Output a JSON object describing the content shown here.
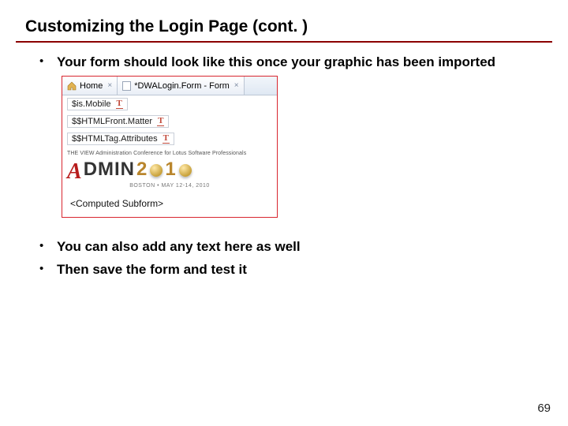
{
  "title": "Customizing the Login Page (cont. )",
  "bullets": {
    "b1": "Your form should look like this once your graphic has been imported",
    "b2": "You can also add any text here as well",
    "b3": "Then save the form and test it"
  },
  "screenshot": {
    "tab_home": "Home",
    "tab_form": "*DWALogin.Form - Form",
    "field_ismobile": "$is.Mobile",
    "field_frontmatter": "$$HTMLFront.Matter",
    "field_tagattrs": "$$HTMLTag.Attributes",
    "logo_topline": "THE VIEW Administration Conference for Lotus Software Professionals",
    "logo_a": "A",
    "logo_dmin": "DMIN",
    "logo_2": "2",
    "logo_1": "1",
    "logo_sub": "BOSTON • MAY 12-14, 2010",
    "subform": "<Computed Subform>"
  },
  "pagenum": "69"
}
